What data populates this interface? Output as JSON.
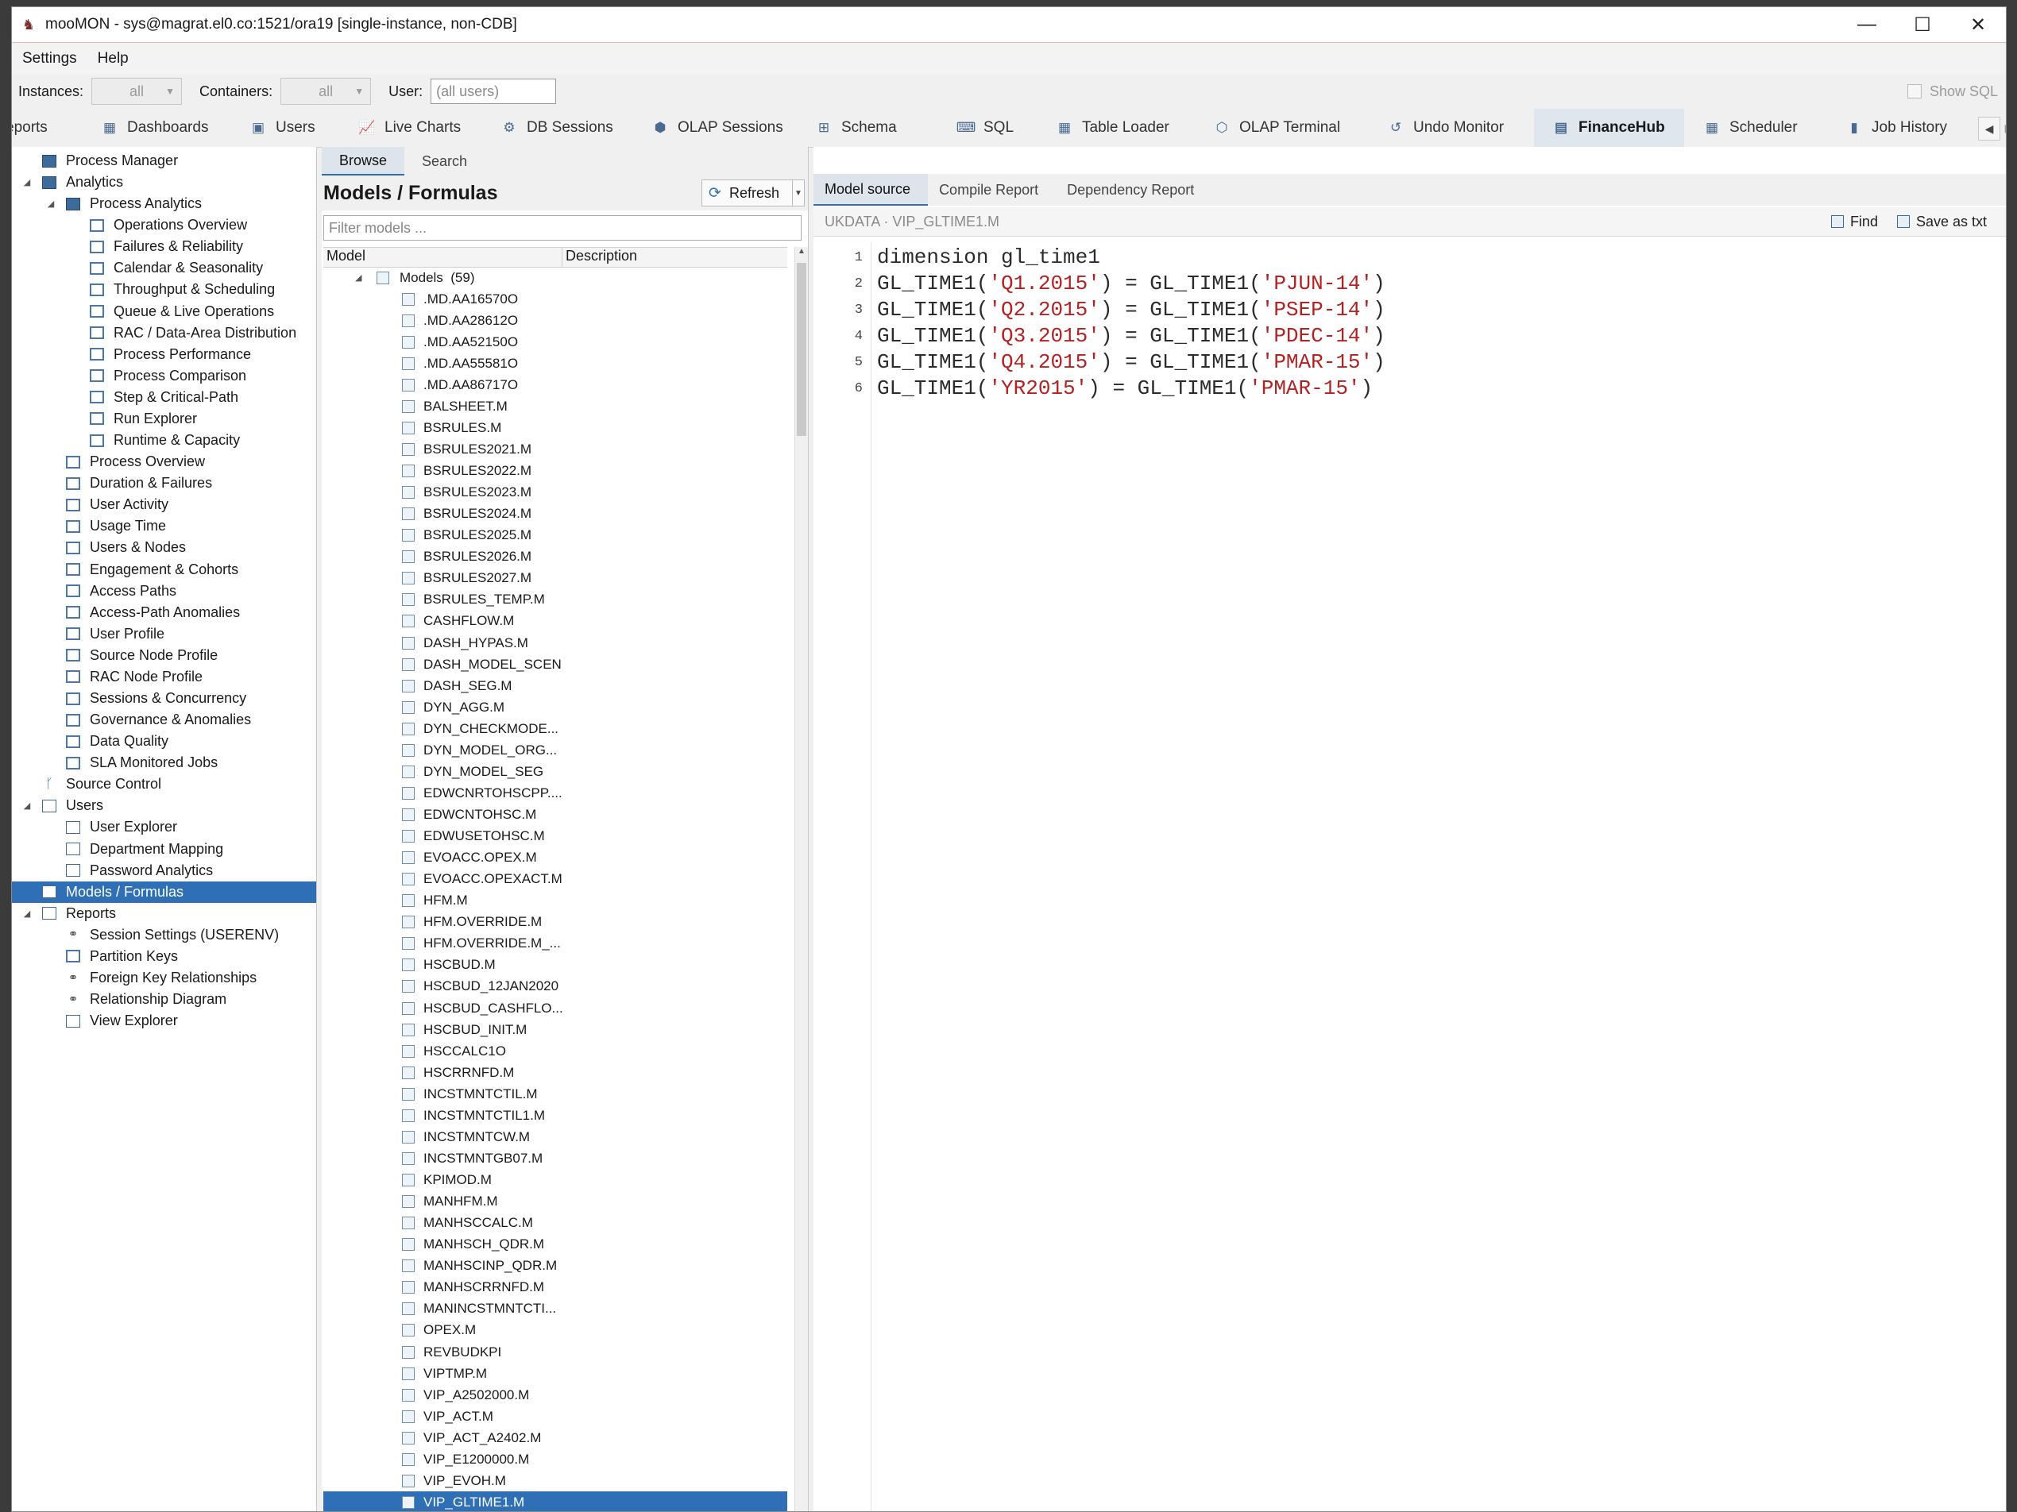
{
  "window": {
    "title": "mooMON - sys@magrat.el0.co:1521/ora19  [single-instance, non-CDB]",
    "controls": {
      "minimize": "—",
      "maximize": "☐",
      "close": "✕"
    }
  },
  "menu": {
    "items": [
      "Settings",
      "Help"
    ]
  },
  "filters": {
    "instances_label": "Instances:",
    "instances_value": "all",
    "containers_label": "Containers:",
    "containers_value": "all",
    "user_label": "User:",
    "user_placeholder": "(all users)",
    "show_sql_label": "Show SQL"
  },
  "tabs": [
    {
      "label": "eports",
      "icon": "reports-icon"
    },
    {
      "label": "Dashboards",
      "icon": "dashboard-icon"
    },
    {
      "label": "Users",
      "icon": "users-icon"
    },
    {
      "label": "Live Charts",
      "icon": "chart-icon"
    },
    {
      "label": "DB Sessions",
      "icon": "sessions-icon"
    },
    {
      "label": "OLAP Sessions",
      "icon": "olap-icon"
    },
    {
      "label": "Schema",
      "icon": "schema-icon"
    },
    {
      "label": "SQL",
      "icon": "sql-icon"
    },
    {
      "label": "Table Loader",
      "icon": "table-icon"
    },
    {
      "label": "OLAP Terminal",
      "icon": "terminal-icon"
    },
    {
      "label": "Undo Monitor",
      "icon": "undo-icon"
    },
    {
      "label": "FinanceHub",
      "icon": "finance-icon",
      "active": true
    },
    {
      "label": "Scheduler",
      "icon": "scheduler-icon"
    },
    {
      "label": "Job History",
      "icon": "history-icon"
    }
  ],
  "tree": [
    {
      "label": "Process Manager",
      "level": 1,
      "icon": "grid"
    },
    {
      "label": "Analytics",
      "level": 1,
      "icon": "grid",
      "expanded": true
    },
    {
      "label": "Process Analytics",
      "level": 2,
      "icon": "grid",
      "expanded": true
    },
    {
      "label": "Operations Overview",
      "level": 3,
      "icon": "grid-l"
    },
    {
      "label": "Failures & Reliability",
      "level": 3,
      "icon": "grid-l"
    },
    {
      "label": "Calendar & Seasonality",
      "level": 3,
      "icon": "grid-l"
    },
    {
      "label": "Throughput & Scheduling",
      "level": 3,
      "icon": "grid-l"
    },
    {
      "label": "Queue & Live Operations",
      "level": 3,
      "icon": "grid-l"
    },
    {
      "label": "RAC / Data-Area Distribution",
      "level": 3,
      "icon": "grid-l"
    },
    {
      "label": "Process Performance",
      "level": 3,
      "icon": "grid-l"
    },
    {
      "label": "Process Comparison",
      "level": 3,
      "icon": "grid-l"
    },
    {
      "label": "Step & Critical-Path",
      "level": 3,
      "icon": "grid-l"
    },
    {
      "label": "Run Explorer",
      "level": 3,
      "icon": "grid-l"
    },
    {
      "label": "Runtime & Capacity",
      "level": 3,
      "icon": "grid-l"
    },
    {
      "label": "Process Overview",
      "level": 2,
      "icon": "grid-l"
    },
    {
      "label": "Duration & Failures",
      "level": 2,
      "icon": "grid-l"
    },
    {
      "label": "User Activity",
      "level": 2,
      "icon": "grid-l"
    },
    {
      "label": "Usage Time",
      "level": 2,
      "icon": "grid-l"
    },
    {
      "label": "Users & Nodes",
      "level": 2,
      "icon": "grid-l"
    },
    {
      "label": "Engagement & Cohorts",
      "level": 2,
      "icon": "grid-l"
    },
    {
      "label": "Access Paths",
      "level": 2,
      "icon": "grid-l"
    },
    {
      "label": "Access-Path Anomalies",
      "level": 2,
      "icon": "grid-l"
    },
    {
      "label": "User Profile",
      "level": 2,
      "icon": "grid-l"
    },
    {
      "label": "Source Node Profile",
      "level": 2,
      "icon": "grid-l"
    },
    {
      "label": "RAC Node Profile",
      "level": 2,
      "icon": "grid-l"
    },
    {
      "label": "Sessions & Concurrency",
      "level": 2,
      "icon": "grid-l"
    },
    {
      "label": "Governance & Anomalies",
      "level": 2,
      "icon": "grid-l"
    },
    {
      "label": "Data Quality",
      "level": 2,
      "icon": "grid-l"
    },
    {
      "label": "SLA Monitored Jobs",
      "level": 2,
      "icon": "grid-l"
    },
    {
      "label": "Source Control",
      "level": 1,
      "icon": "branch"
    },
    {
      "label": "Users",
      "level": 1,
      "icon": "doc",
      "expanded": true
    },
    {
      "label": "User Explorer",
      "level": 2,
      "icon": "doc"
    },
    {
      "label": "Department Mapping",
      "level": 2,
      "icon": "doc"
    },
    {
      "label": "Password Analytics",
      "level": 2,
      "icon": "doc"
    },
    {
      "label": "Models / Formulas",
      "level": 1,
      "icon": "doc",
      "selected": true
    },
    {
      "label": "Reports",
      "level": 1,
      "icon": "doc",
      "expanded": true
    },
    {
      "label": "Session Settings (USERENV)",
      "level": 2,
      "icon": "link"
    },
    {
      "label": "Partition Keys",
      "level": 2,
      "icon": "grid-l"
    },
    {
      "label": "Foreign Key Relationships",
      "level": 2,
      "icon": "link"
    },
    {
      "label": "Relationship Diagram",
      "level": 2,
      "icon": "link"
    },
    {
      "label": "View Explorer",
      "level": 2,
      "icon": "doc"
    }
  ],
  "browser": {
    "subtabs": [
      "Browse",
      "Search"
    ],
    "title": "Models / Formulas",
    "refresh_label": "Refresh",
    "filter_placeholder": "Filter models ...",
    "col_model": "Model",
    "col_description": "Description",
    "group_label": "Models",
    "group_count": "(59)",
    "models": [
      ".MD.AA16570O",
      ".MD.AA28612O",
      ".MD.AA52150O",
      ".MD.AA55581O",
      ".MD.AA86717O",
      "BALSHEET.M",
      "BSRULES.M",
      "BSRULES2021.M",
      "BSRULES2022.M",
      "BSRULES2023.M",
      "BSRULES2024.M",
      "BSRULES2025.M",
      "BSRULES2026.M",
      "BSRULES2027.M",
      "BSRULES_TEMP.M",
      "CASHFLOW.M",
      "DASH_HYPAS.M",
      "DASH_MODEL_SCEN",
      "DASH_SEG.M",
      "DYN_AGG.M",
      "DYN_CHECKMODE...",
      "DYN_MODEL_ORG...",
      "DYN_MODEL_SEG",
      "EDWCNRTOHSCPP....",
      "EDWCNTOHSC.M",
      "EDWUSETOHSC.M",
      "EVOACC.OPEX.M",
      "EVOACC.OPEXACT.M",
      "HFM.M",
      "HFM.OVERRIDE.M",
      "HFM.OVERRIDE.M_...",
      "HSCBUD.M",
      "HSCBUD_12JAN2020",
      "HSCBUD_CASHFLO...",
      "HSCBUD_INIT.M",
      "HSCCALC1O",
      "HSCRRNFD.M",
      "INCSTMNTCTIL.M",
      "INCSTMNTCTIL1.M",
      "INCSTMNTCW.M",
      "INCSTMNTGB07.M",
      "KPIMOD.M",
      "MANHFM.M",
      "MANHSCCALC.M",
      "MANHSCH_QDR.M",
      "MANHSCINP_QDR.M",
      "MANHSCRRNFD.M",
      "MANINCSTMNTCTI...",
      "OPEX.M",
      "REVBUDKPI",
      "VIPTMP.M",
      "VIP_A2502000.M",
      "VIP_ACT.M",
      "VIP_ACT_A2402.M",
      "VIP_E1200000.M",
      "VIP_EVOH.M",
      "VIP_GLTIME1.M"
    ],
    "selected_model": "VIP_GLTIME1.M"
  },
  "source": {
    "tabs": [
      "Model source",
      "Compile Report",
      "Dependency Report"
    ],
    "path": "UKDATA  ·  VIP_GLTIME1.M",
    "find_label": "Find",
    "save_label": "Save as txt",
    "lines": [
      {
        "n": "1",
        "parts": [
          [
            "t",
            "dimension gl_time1"
          ]
        ]
      },
      {
        "n": "2",
        "parts": [
          [
            "t",
            "GL_TIME1("
          ],
          [
            "s",
            "'Q1.2015'"
          ],
          [
            "t",
            ") = GL_TIME1("
          ],
          [
            "s",
            "'PJUN-14'"
          ],
          [
            "t",
            ")"
          ]
        ]
      },
      {
        "n": "3",
        "parts": [
          [
            "t",
            "GL_TIME1("
          ],
          [
            "s",
            "'Q2.2015'"
          ],
          [
            "t",
            ") = GL_TIME1("
          ],
          [
            "s",
            "'PSEP-14'"
          ],
          [
            "t",
            ")"
          ]
        ]
      },
      {
        "n": "4",
        "parts": [
          [
            "t",
            "GL_TIME1("
          ],
          [
            "s",
            "'Q3.2015'"
          ],
          [
            "t",
            ") = GL_TIME1("
          ],
          [
            "s",
            "'PDEC-14'"
          ],
          [
            "t",
            ")"
          ]
        ]
      },
      {
        "n": "5",
        "parts": [
          [
            "t",
            "GL_TIME1("
          ],
          [
            "s",
            "'Q4.2015'"
          ],
          [
            "t",
            ") = GL_TIME1("
          ],
          [
            "s",
            "'PMAR-15'"
          ],
          [
            "t",
            ")"
          ]
        ]
      },
      {
        "n": "6",
        "parts": [
          [
            "t",
            "GL_TIME1("
          ],
          [
            "s",
            "'YR2015'"
          ],
          [
            "t",
            ") = GL_TIME1("
          ],
          [
            "s",
            "'PMAR-15'"
          ],
          [
            "t",
            ")"
          ]
        ]
      }
    ]
  },
  "colors": {
    "accent": "#2f6fb5",
    "string": "#b22222"
  }
}
